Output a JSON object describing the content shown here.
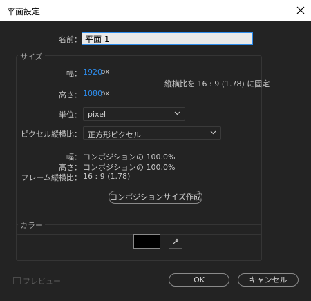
{
  "window": {
    "title": "平面設定"
  },
  "name": {
    "label": "名前：",
    "value": "平面 1"
  },
  "size": {
    "group_title": "サイズ",
    "width_label": "幅：",
    "width_value": "1920",
    "width_unit": "px",
    "height_label": "高さ：",
    "height_value": "1080",
    "height_unit": "px",
    "lock_label": "縦横比を 16 : 9 (1.78) に固定",
    "lock_checked": false,
    "unit_label": "単位：",
    "unit_value": "pixel",
    "pixel_aspect_label": "ピクセル縦横比：",
    "pixel_aspect_value": "正方形ピクセル",
    "info_width_label": "幅：",
    "info_width_value": "コンポジションの 100.0%",
    "info_height_label": "高さ：",
    "info_height_value": "コンポジションの 100.0%",
    "info_frame_label": "フレーム縦横比：",
    "info_frame_value": "16 : 9 (1.78)",
    "make_comp_size_label": "コンポジションサイズ作成"
  },
  "color": {
    "group_title": "カラー",
    "swatch_color": "#000000"
  },
  "footer": {
    "preview_label": "プレビュー",
    "preview_checked": false,
    "ok_label": "OK",
    "cancel_label": "キャンセル"
  },
  "colors": {
    "accent": "#2d8ceb",
    "background": "#232323"
  }
}
